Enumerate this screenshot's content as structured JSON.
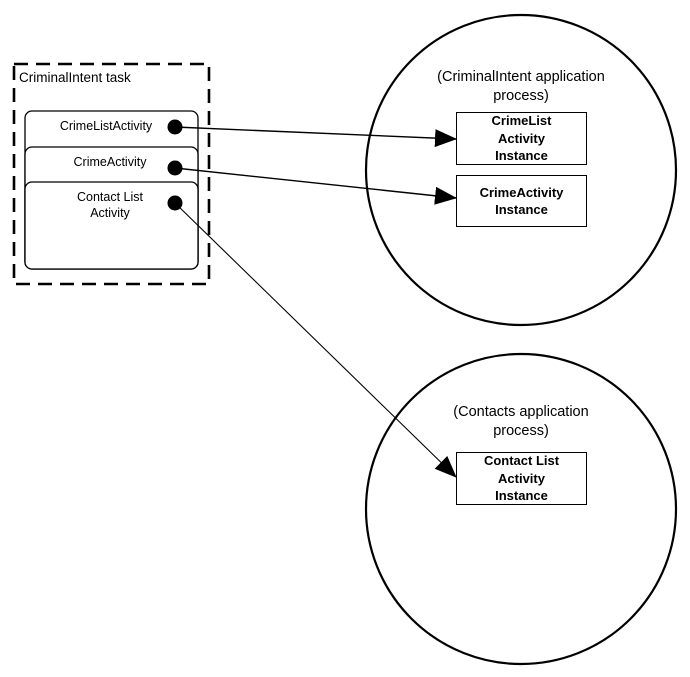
{
  "task": {
    "title": "CriminalIntent task",
    "activities": [
      {
        "label": "CrimeListActivity"
      },
      {
        "label": "CrimeActivity"
      },
      {
        "label": "Contact List\nActivity"
      }
    ]
  },
  "processes": [
    {
      "label": "(CriminalIntent application\nprocess)",
      "instances": [
        {
          "label": "CrimeList\nActivity\nInstance"
        },
        {
          "label": "CrimeActivity\nInstance"
        }
      ]
    },
    {
      "label": "(Contacts application\nprocess)",
      "instances": [
        {
          "label": "Contact List\nActivity\nInstance"
        }
      ]
    }
  ],
  "connections": [
    {
      "from": "CrimeListActivity",
      "to": "CrimeList Activity Instance"
    },
    {
      "from": "CrimeActivity",
      "to": "CrimeActivity Instance"
    },
    {
      "from": "Contact List Activity",
      "to": "Contact List Activity Instance"
    }
  ]
}
